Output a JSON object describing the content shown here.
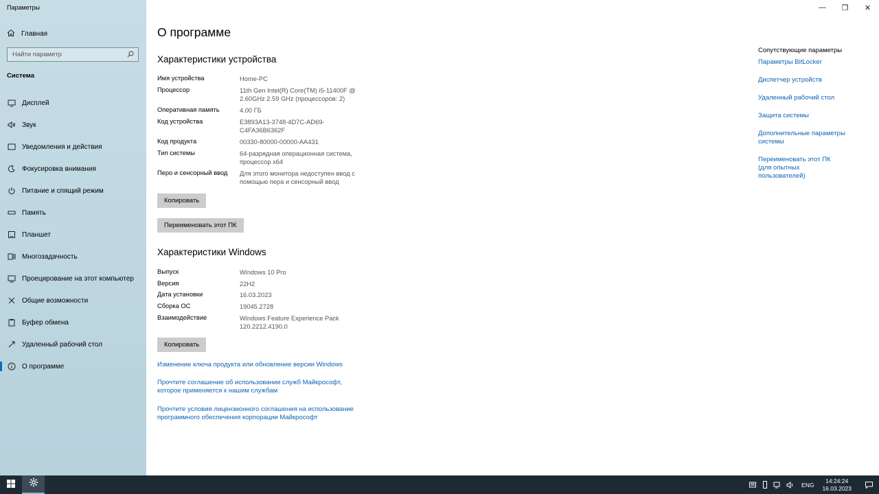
{
  "app": {
    "title": "Параметры"
  },
  "window": {
    "minimize": "—",
    "maximize": "❐",
    "close": "✕"
  },
  "sidebar": {
    "home_label": "Главная",
    "search_placeholder": "Найти параметр",
    "section": "Система",
    "items": [
      {
        "label": "Дисплей",
        "icon": "display-icon"
      },
      {
        "label": "Звук",
        "icon": "sound-icon"
      },
      {
        "label": "Уведомления и действия",
        "icon": "notifications-icon"
      },
      {
        "label": "Фокусировка внимания",
        "icon": "focus-icon"
      },
      {
        "label": "Питание и спящий режим",
        "icon": "power-icon"
      },
      {
        "label": "Память",
        "icon": "storage-icon"
      },
      {
        "label": "Планшет",
        "icon": "tablet-icon"
      },
      {
        "label": "Многозадачность",
        "icon": "multitasking-icon"
      },
      {
        "label": "Проецирование на этот компьютер",
        "icon": "projecting-icon"
      },
      {
        "label": "Общие возможности",
        "icon": "shared-experiences-icon"
      },
      {
        "label": "Буфер обмена",
        "icon": "clipboard-icon"
      },
      {
        "label": "Удаленный рабочий стол",
        "icon": "remote-desktop-icon"
      },
      {
        "label": "О программе",
        "icon": "about-icon",
        "active": true
      }
    ]
  },
  "main": {
    "title": "О программе",
    "device": {
      "heading": "Характеристики устройства",
      "rows": [
        {
          "k": "Имя устройства",
          "v": "Home-PC"
        },
        {
          "k": "Процессор",
          "v": "11th Gen Intel(R) Core(TM) i5-11400F @ 2.60GHz   2.59 GHz (процессоров: 2)"
        },
        {
          "k": "Оперативная память",
          "v": "4.00 ГБ"
        },
        {
          "k": "Код устройства",
          "v": "E3893A13-3748-4D7C-AD69-C4FA36B6362F"
        },
        {
          "k": "Код продукта",
          "v": "00330-80000-00000-AA431"
        },
        {
          "k": "Тип системы",
          "v": "64-разрядная операционная система, процессор x64"
        },
        {
          "k": "Перо и сенсорный ввод",
          "v": "Для этого монитора недоступен ввод с помощью пера и сенсорный ввод"
        }
      ],
      "copy_label": "Копировать",
      "rename_label": "Переименовать этот ПК"
    },
    "windows": {
      "heading": "Характеристики Windows",
      "rows": [
        {
          "k": "Выпуск",
          "v": "Windows 10 Pro"
        },
        {
          "k": "Версия",
          "v": "22H2"
        },
        {
          "k": "Дата установки",
          "v": "16.03.2023"
        },
        {
          "k": "Сборка ОС",
          "v": "19045.2728"
        },
        {
          "k": "Взаимодействие",
          "v": "Windows Feature Experience Pack 120.2212.4190.0"
        }
      ],
      "copy_label": "Копировать"
    },
    "links": [
      "Изменение ключа продукта или обновление версии Windows",
      "Прочтите соглашение об использовании служб Майкрософт, которое применяется к нашим службам",
      "Прочтите условия лицензионного соглашения на использование программного обеспечения корпорации Майкрософт"
    ]
  },
  "related": {
    "title": "Сопутствующие параметры",
    "links": [
      "Параметры BitLocker",
      "Диспетчер устройств",
      "Удаленный рабочий стол",
      "Защита системы",
      "Дополнительные параметры системы",
      "Переименовать этот ПК (для опытных пользователей)"
    ]
  },
  "taskbar": {
    "lang": "ENG",
    "time": "14:24:24",
    "date": "16.03.2023"
  },
  "colors": {
    "accent": "#0a6fb8",
    "link": "#0b63b5",
    "sidebar": "#c7dde6",
    "taskbar": "#1d2a34"
  }
}
